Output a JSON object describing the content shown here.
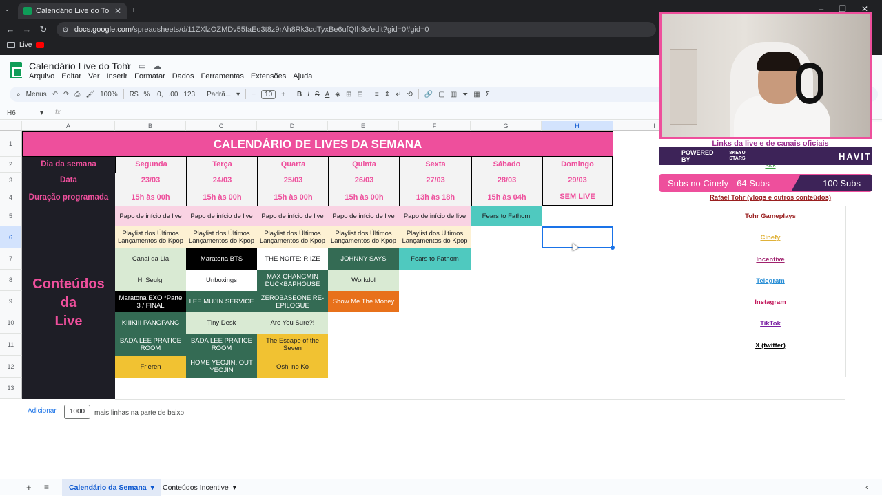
{
  "browser": {
    "tab_title": "Calendário Live do Tohr - Goog",
    "url_domain": "docs.google.com",
    "url_path": "/spreadsheets/d/11ZXlzOZMDv55IaEo3t8z9rAh8Rk3cdTyxBe6ufQIh3c/edit?gid=0#gid=0",
    "bookmark_folder": "Live"
  },
  "doc": {
    "title": "Calendário Live do Tohr",
    "menu": [
      "Arquivo",
      "Editar",
      "Ver",
      "Inserir",
      "Formatar",
      "Dados",
      "Ferramentas",
      "Extensões",
      "Ajuda"
    ]
  },
  "toolbar": {
    "search": "Menus",
    "zoom": "100%",
    "currency": "R$",
    "percent": "%",
    "dec_less": ".0,",
    "dec_more": ".00",
    "number_fmt": "123",
    "font": "Padrã...",
    "font_size": "10"
  },
  "formula": {
    "name_box": "H6",
    "fx": "fx"
  },
  "columns": [
    "A",
    "B",
    "C",
    "D",
    "E",
    "F",
    "G",
    "H",
    "I"
  ],
  "rows": [
    "1",
    "2",
    "3",
    "4",
    "5",
    "6",
    "7",
    "8",
    "9",
    "10",
    "11",
    "12",
    "13"
  ],
  "sheet": {
    "title": "CALENDÁRIO DE LIVES DA SEMANA",
    "row_labels": [
      "Dia da semana",
      "Data",
      "Duração programada"
    ],
    "days": [
      {
        "name": "Segunda",
        "date": "23/03",
        "duration": "15h às 00h"
      },
      {
        "name": "Terça",
        "date": "24/03",
        "duration": "15h às 00h"
      },
      {
        "name": "Quarta",
        "date": "25/03",
        "duration": "15h às 00h"
      },
      {
        "name": "Quinta",
        "date": "26/03",
        "duration": "15h às 00h"
      },
      {
        "name": "Sexta",
        "date": "27/03",
        "duration": "13h às 18h"
      },
      {
        "name": "Sábado",
        "date": "28/03",
        "duration": "15h às 04h"
      },
      {
        "name": "Domingo",
        "date": "29/03",
        "duration": "SEM LIVE"
      }
    ],
    "conteudos_label": "Conteúdos da Live",
    "content": {
      "r5": [
        "Papo de início de live",
        "Papo de início de live",
        "Papo de início de live",
        "Papo de início de live",
        "Papo de início de live",
        "Fears to Fathom"
      ],
      "r6": [
        "Playlist dos Últimos Lançamentos do Kpop",
        "Playlist dos Últimos Lançamentos do Kpop",
        "Playlist dos Últimos Lançamentos do Kpop",
        "Playlist dos Últimos Lançamentos do Kpop",
        "Playlist dos Últimos Lançamentos do Kpop"
      ],
      "r7": [
        "Canal da Lia",
        "Maratona BTS",
        "THE NOITE: RIIZE",
        "JOHNNY SAYS",
        "Fears to Fathom"
      ],
      "r8": [
        "Hi Seulgi",
        "Unboxings",
        "MAX CHANGMIN DUCKBAPHOUSE",
        "Workdol"
      ],
      "r9": [
        "Maratona EXO *Parte 3 / FINAL",
        "LEE MUJIN SERVICE",
        "ZEROBASEONE RE-EPILOGUE",
        "Show Me The Money"
      ],
      "r10": [
        "KIIIKIII PANGPANG",
        "Tiny Desk",
        "Are You Sure?!"
      ],
      "r11": [
        "BADA LEE PRATICE ROOM",
        "BADA LEE PRATICE ROOM",
        "The Escape of the Seven"
      ],
      "r12": [
        "Frieren",
        "HOME YEOJIN, OUT YEOJIN",
        "Oshi no Ko"
      ]
    }
  },
  "links": {
    "header": "Links da live e de canais oficiais",
    "kick": "Kick",
    "items": [
      {
        "label": "Rafael Tohr (vlogs e outros conteúdos)",
        "color": "#9a1f1f"
      },
      {
        "label": "Tohr Gameplays",
        "color": "#9a1f1f"
      },
      {
        "label": "Cinefy",
        "color": "#e0b23a"
      },
      {
        "label": "Incentive",
        "color": "#a0226e"
      },
      {
        "label": "Telegram",
        "color": "#2a8fd6"
      },
      {
        "label": "Instagram",
        "color": "#c2185b"
      },
      {
        "label": "TikTok",
        "color": "#7a1fa2"
      },
      {
        "label": "X (twitter)",
        "color": "#000000"
      }
    ]
  },
  "overlay": {
    "powered_by": "POWERED BY",
    "sponsor_small": "8KEYU STARS",
    "sponsor_big": "HAVIT",
    "subs_label": "Subs no Cinefy",
    "subs_current": "64 Subs",
    "subs_goal": "100 Subs"
  },
  "footer": {
    "add_label": "Adicionar",
    "add_count": "1000",
    "add_suffix": "mais linhas na parte de baixo",
    "tabs": [
      "Calendário da Semana",
      "Conteúdos Incentive"
    ]
  },
  "colors": {
    "accent": "#ee4f9c",
    "dark": "#1e1e26",
    "selection": "#1a73e8"
  }
}
